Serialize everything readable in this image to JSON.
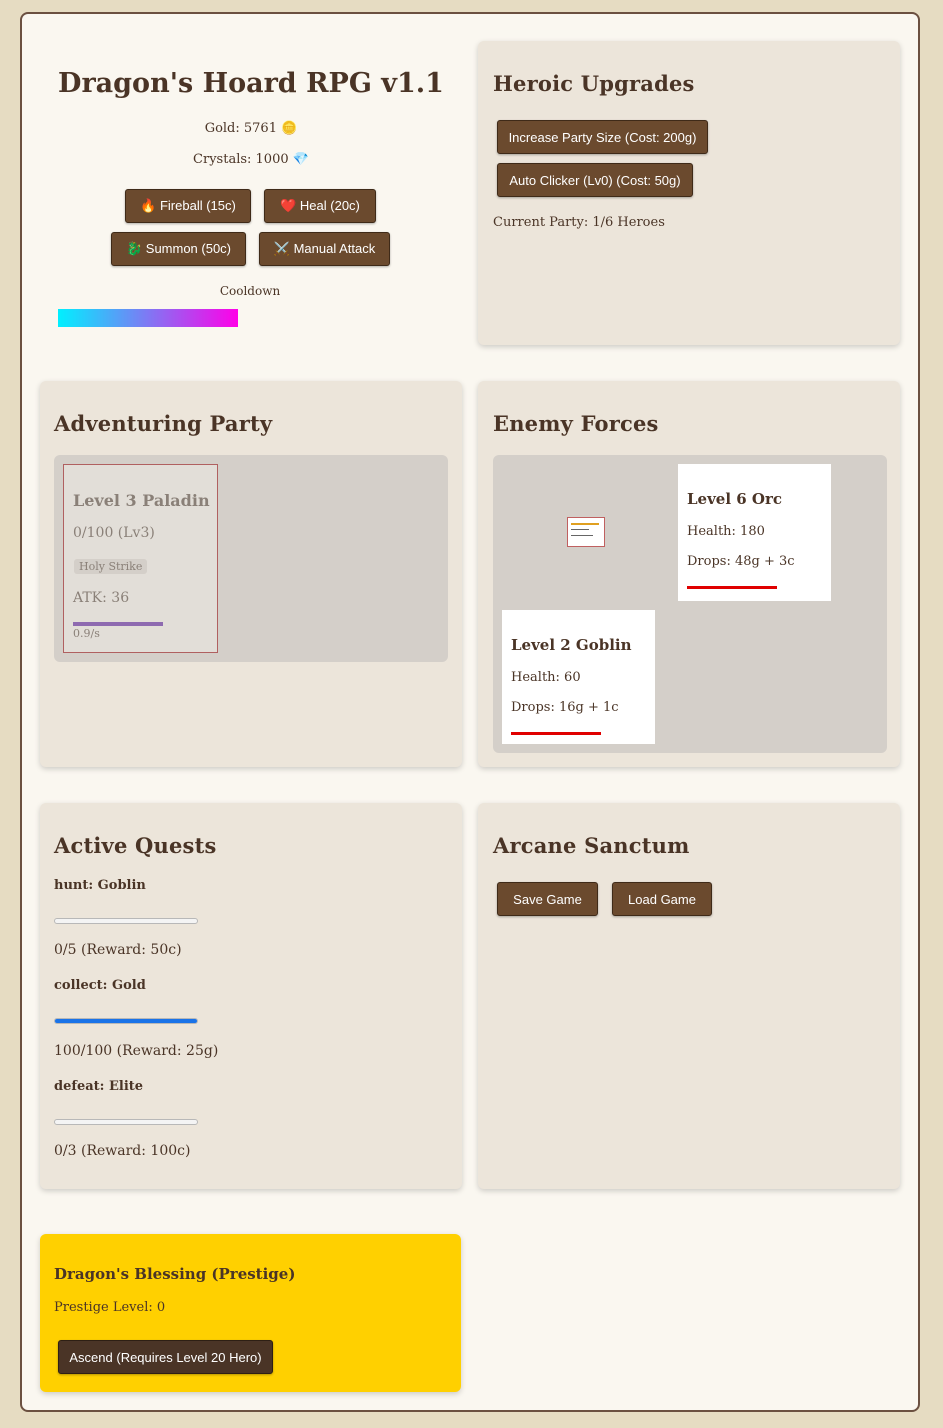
{
  "header": {
    "title": "Dragon's Hoard RPG v1.1",
    "gold": "Gold: 5761 🪙",
    "crystals": "Crystals: 1000 💎",
    "spells": {
      "fireball": "🔥 Fireball (15c)",
      "heal": "❤️ Heal (20c)",
      "summon": "🐉 Summon (50c)",
      "manual_attack": "⚔️ Manual Attack"
    },
    "cooldown_label": "Cooldown"
  },
  "upgrades": {
    "title": "Heroic Upgrades",
    "party_size_button": "Increase Party Size (Cost: 200g)",
    "auto_clicker_button": "Auto Clicker (Lv0) (Cost: 50g)",
    "current_party": "Current Party: 1/6 Heroes"
  },
  "party": {
    "title": "Adventuring Party",
    "hero": {
      "name": "Level 3 Paladin",
      "xp": "0/100 (Lv3)",
      "skill": "Holy Strike",
      "attack": "ATK: 36",
      "speed": "0.9/s",
      "attack_progress": 1.0
    }
  },
  "enemies": {
    "title": "Enemy Forces",
    "list": [
      {
        "name": "Level 6 Orc",
        "health": "Health: 180",
        "drops": "Drops: 48g + 3c",
        "health_fraction": 1.0
      },
      {
        "name": "Level 2 Goblin",
        "health": "Health: 60",
        "drops": "Drops: 16g + 1c",
        "health_fraction": 1.0
      }
    ]
  },
  "quests": {
    "title": "Active Quests",
    "list": [
      {
        "name": "hunt: Goblin",
        "progress_text": "0/5 (Reward: 50c)",
        "progress": 0.0
      },
      {
        "name": "collect: Gold",
        "progress_text": "100/100 (Reward: 25g)",
        "progress": 1.0
      },
      {
        "name": "defeat: Elite",
        "progress_text": "0/3 (Reward: 100c)",
        "progress": 0.0
      }
    ]
  },
  "sanctum": {
    "title": "Arcane Sanctum",
    "save_button": "Save Game",
    "load_button": "Load Game"
  },
  "prestige": {
    "title": "Dragon's Blessing (Prestige)",
    "level": "Prestige Level: 0",
    "ascend_button": "Ascend (Requires Level 20 Hero)"
  },
  "colors": {
    "button": "#6b4a2e",
    "prestige_panel": "#ffd000",
    "quest_bar": "#1a73e8",
    "enemy_health": "#e00000",
    "hero_border": "#b06060",
    "attack_bar": "#8e6ab0"
  }
}
